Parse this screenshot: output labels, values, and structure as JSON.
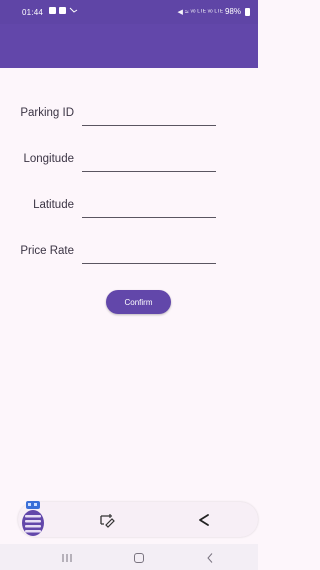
{
  "status_bar": {
    "time": "01:44",
    "right_icons": "◀ ≈ ᵛᵒ ᴸᵀᴱ ᵛᵒ ᴸᵀᴱ",
    "battery": "98%",
    "icons": [
      "image-icon",
      "message-icon",
      "missed-call-icon",
      "mute-icon",
      "wifi-icon",
      "signal-icon",
      "battery-icon"
    ]
  },
  "app_bar": {
    "color": "#6247aa"
  },
  "form": {
    "fields": [
      {
        "label": "Parking ID",
        "value": ""
      },
      {
        "label": "Longitude",
        "value": ""
      },
      {
        "label": "Latitude",
        "value": ""
      },
      {
        "label": "Price Rate",
        "value": ""
      }
    ],
    "confirm_label": "Confirm"
  },
  "toolbar": {
    "icons": [
      "app-launcher-icon",
      "edit-screenshot-icon",
      "share-icon"
    ]
  },
  "nav_bar": {
    "icons": [
      "recent-apps-icon",
      "home-icon",
      "back-icon"
    ]
  },
  "colors": {
    "primary": "#6247aa",
    "background": "#fdf6fb",
    "text": "#3b3444"
  }
}
